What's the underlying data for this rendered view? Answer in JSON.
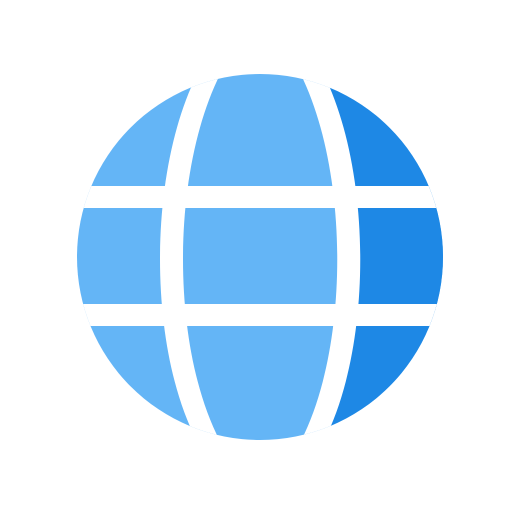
{
  "icon": {
    "name": "globe-icon",
    "colors": {
      "light_blue": "#64B5F6",
      "dark_blue": "#1E88E5",
      "gap": "#FFFFFF",
      "background": "#FFFFFF"
    }
  }
}
